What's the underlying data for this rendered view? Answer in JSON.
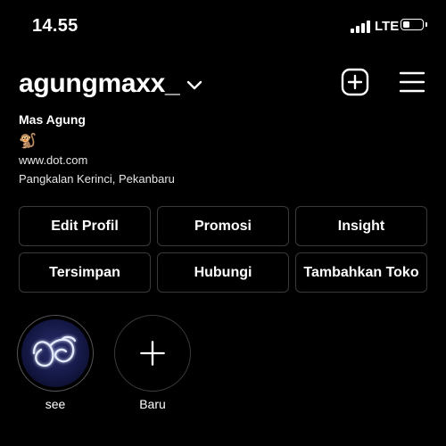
{
  "status_bar": {
    "time": "14.55",
    "network": "LTE",
    "battery_level": 0.35,
    "signal_bars": 4
  },
  "header": {
    "username": "agungmaxx_",
    "icons": [
      "chevron-down-icon",
      "new-post-icon",
      "menu-icon"
    ]
  },
  "profile": {
    "display_name": "Mas Agung",
    "bio_emoji": "🐒",
    "website": "www.dot.com",
    "location": "Pangkalan Kerinci, Pekanbaru"
  },
  "actions": {
    "row1": [
      "Edit Profil",
      "Promosi",
      "Insight"
    ],
    "row2": [
      "Tersimpan",
      "Hubungi",
      "Tambahkan Toko"
    ]
  },
  "highlights": [
    {
      "label": "see"
    },
    {
      "label": "Baru"
    }
  ],
  "colors": {
    "background": "#000000",
    "text": "#ffffff",
    "button_border": "#3a3a3a"
  }
}
